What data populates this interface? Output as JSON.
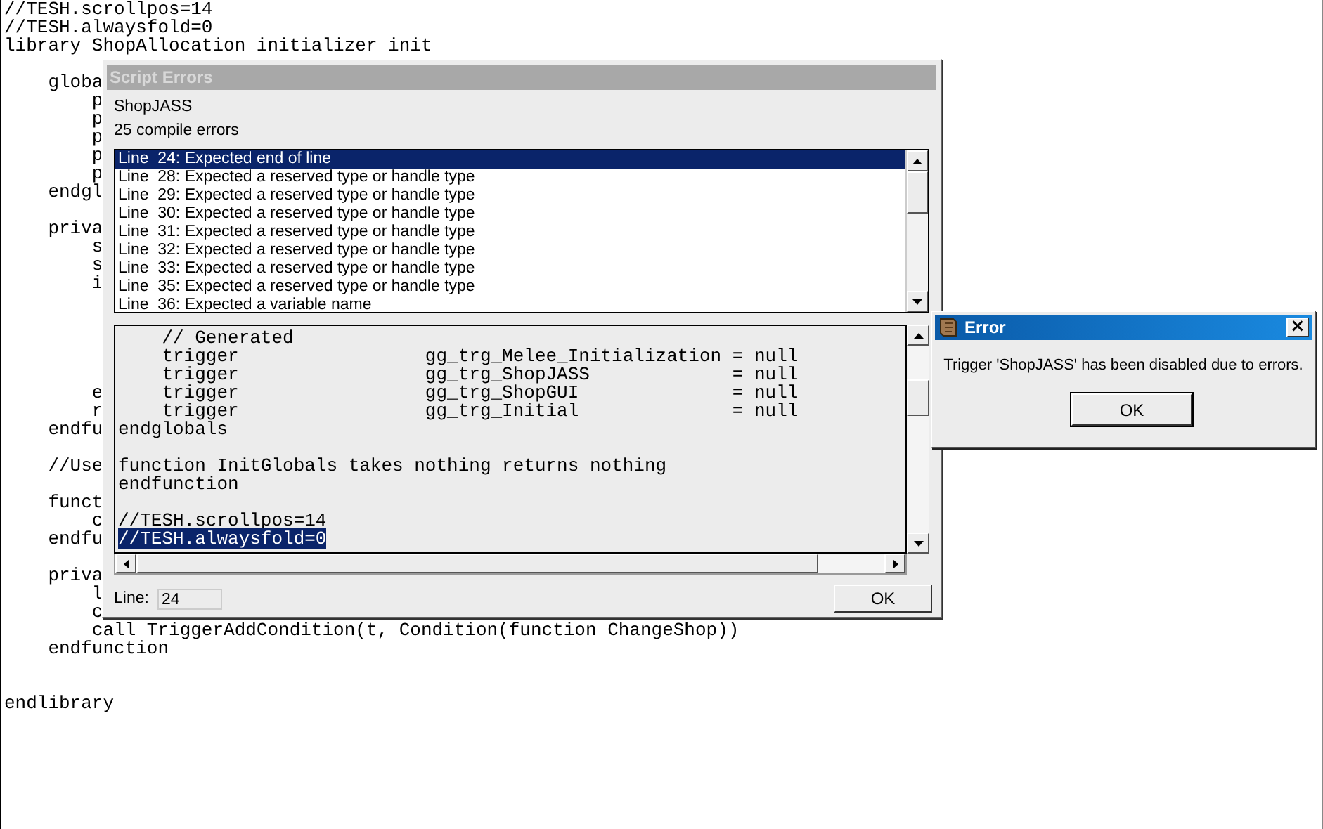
{
  "editor": {
    "lines": [
      {
        "kind": "code",
        "text": "//TESH.scrollpos=14"
      },
      {
        "kind": "code",
        "text": "//TESH.alwaysfold=0"
      },
      {
        "kind": "code",
        "text": "library ShopAllocation initializer init"
      },
      {
        "kind": "blank"
      },
      {
        "kind": "code",
        "text": "    globa"
      },
      {
        "kind": "code",
        "text": "        p"
      },
      {
        "kind": "code",
        "text": "        p"
      },
      {
        "kind": "code",
        "text": "        p"
      },
      {
        "kind": "code",
        "text": "        p"
      },
      {
        "kind": "code",
        "text": "        p"
      },
      {
        "kind": "code",
        "text": "    endgl"
      },
      {
        "kind": "blank"
      },
      {
        "kind": "code",
        "text": "    priva"
      },
      {
        "kind": "code",
        "text": "        s"
      },
      {
        "kind": "code",
        "text": "        s"
      },
      {
        "kind": "code",
        "text": "        i"
      },
      {
        "kind": "blank"
      },
      {
        "kind": "blank"
      },
      {
        "kind": "blank"
      },
      {
        "kind": "blank"
      },
      {
        "kind": "blank"
      },
      {
        "kind": "code",
        "text": "        e"
      },
      {
        "kind": "code",
        "text": "        r"
      },
      {
        "kind": "code",
        "text": "    endfu"
      },
      {
        "kind": "blank"
      },
      {
        "kind": "code",
        "text": "    //Use"
      },
      {
        "kind": "blank"
      },
      {
        "kind": "code",
        "text": "    funct"
      },
      {
        "kind": "code",
        "text": "        c"
      },
      {
        "kind": "code",
        "text": "    endfu"
      },
      {
        "kind": "blank"
      },
      {
        "kind": "code",
        "text": "    priva"
      },
      {
        "kind": "code",
        "text": "        l"
      },
      {
        "kind": "code",
        "text": "        c"
      },
      {
        "kind": "code",
        "text": "        call TriggerAddCondition(t, Condition(function ChangeShop))"
      },
      {
        "kind": "code",
        "text": "    endfunction"
      },
      {
        "kind": "blank"
      },
      {
        "kind": "blank"
      },
      {
        "kind": "code",
        "text": "endlibrary"
      }
    ]
  },
  "script_errors": {
    "title": "Script Errors",
    "trigger_name": "ShopJASS",
    "error_count": "25 compile errors",
    "errors": [
      {
        "text": "Line  24: Expected end of line",
        "selected": true
      },
      {
        "text": "Line  28: Expected a reserved type or handle type",
        "selected": false
      },
      {
        "text": "Line  29: Expected a reserved type or handle type",
        "selected": false
      },
      {
        "text": "Line  30: Expected a reserved type or handle type",
        "selected": false
      },
      {
        "text": "Line  31: Expected a reserved type or handle type",
        "selected": false
      },
      {
        "text": "Line  32: Expected a reserved type or handle type",
        "selected": false
      },
      {
        "text": "Line  33: Expected a reserved type or handle type",
        "selected": false
      },
      {
        "text": "Line  35: Expected a reserved type or handle type",
        "selected": false
      },
      {
        "text": "Line  36: Expected a variable name",
        "selected": false
      }
    ],
    "code_lines": [
      {
        "kind": "code",
        "text": "    // Generated",
        "selected": false
      },
      {
        "kind": "code",
        "text": "    trigger                 gg_trg_Melee_Initialization = null",
        "selected": false
      },
      {
        "kind": "code",
        "text": "    trigger                 gg_trg_ShopJASS             = null",
        "selected": false
      },
      {
        "kind": "code",
        "text": "    trigger                 gg_trg_ShopGUI              = null",
        "selected": false
      },
      {
        "kind": "code",
        "text": "    trigger                 gg_trg_Initial              = null",
        "selected": false
      },
      {
        "kind": "code",
        "text": "endglobals",
        "selected": false
      },
      {
        "kind": "blank",
        "selected": false
      },
      {
        "kind": "code",
        "text": "function InitGlobals takes nothing returns nothing",
        "selected": false
      },
      {
        "kind": "code",
        "text": "endfunction",
        "selected": false
      },
      {
        "kind": "blank",
        "selected": false
      },
      {
        "kind": "code",
        "text": "//TESH.scrollpos=14",
        "selected": false
      },
      {
        "kind": "code",
        "text": "//TESH.alwaysfold=0",
        "selected": true
      }
    ],
    "line_label": "Line:",
    "line_value": "24",
    "ok": "OK"
  },
  "error_dialog": {
    "title": "Error",
    "close": "×",
    "message": "Trigger 'ShopJASS' has been disabled due to errors.",
    "ok": "OK"
  }
}
